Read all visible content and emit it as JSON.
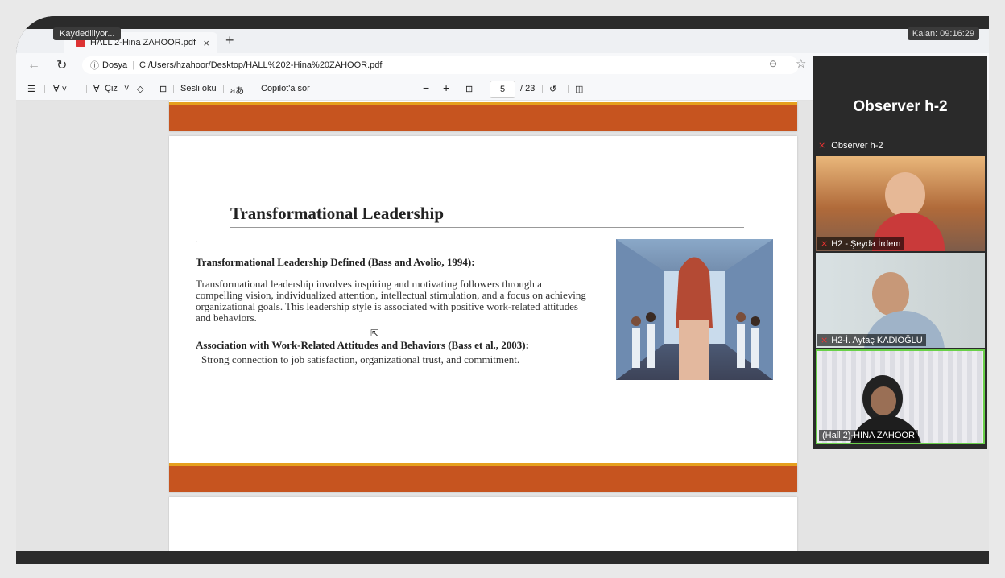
{
  "recording": {
    "label": "Kaydediliyor..."
  },
  "timer": {
    "label": "Kalan: 09:16:29"
  },
  "tab": {
    "title": "HALL 2-Hina ZAHOOR.pdf",
    "close": "×",
    "new": "+"
  },
  "address": {
    "info_label": "Dosya",
    "url": "C:/Users/hzahoor/Desktop/HALL%202-Hina%20ZAHOOR.pdf"
  },
  "toolbar": {
    "draw_label": "Çiz",
    "read_aloud": "Sesli oku",
    "translate_glyph": "aあ",
    "copilot": "Copilot'a sor",
    "page_current": "5",
    "page_total": "/ 23"
  },
  "slide": {
    "title": "Transformational Leadership",
    "dot": ".",
    "heading1": "Transformational Leadership Defined (Bass and Avolio, 1994):",
    "para1": "Transformational leadership involves inspiring and motivating followers through a compelling vision, individualized attention, intellectual stimulation, and a focus on achieving organizational goals. This leadership style is associated with positive work-related attitudes and behaviors.",
    "heading2": "Association with Work-Related Attitudes and Behaviors (Bass et al., 2003):",
    "para2": "Strong connection to job satisfaction, organizational trust, and commitment."
  },
  "panel": {
    "title": "Observer h-2",
    "observer_label": "Observer h-2",
    "participants": [
      {
        "name": "H2 - Şeyda İrdem"
      },
      {
        "name": "H2-İ. Aytaç KADIOĞLU"
      },
      {
        "name": "(Hall 2)-HINA ZAHOOR"
      }
    ]
  },
  "colors": {
    "slide_bar": "#c6541f",
    "slide_bar_top": "#e6a01e",
    "active_speaker": "#6ad04a"
  }
}
